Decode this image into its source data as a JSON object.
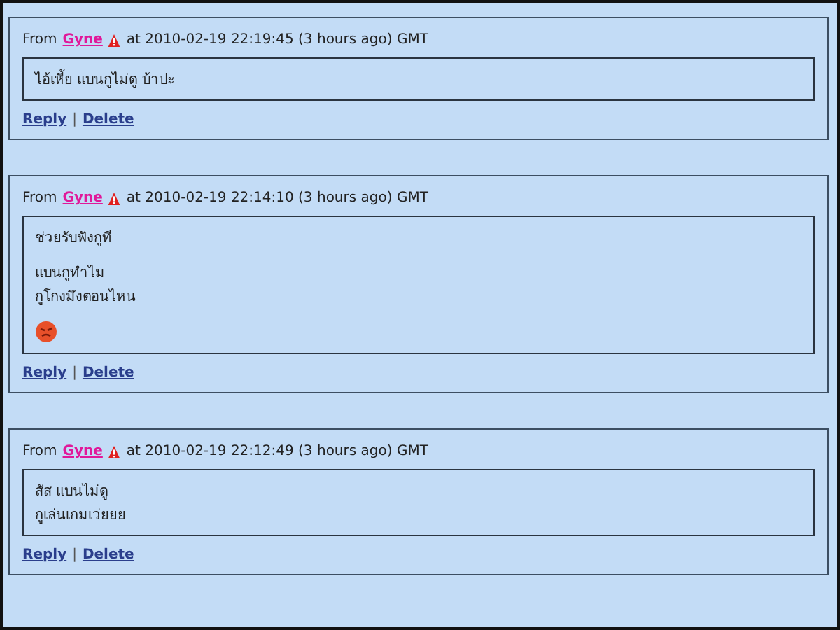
{
  "comments": [
    {
      "from_label": "From",
      "author": "Gyne",
      "timestamp": "at 2010-02-19 22:19:45 (3 hours ago) GMT",
      "paragraphs": [
        [
          "ไอ้เหี้ย แบนกูไม่ดู บ้าปะ"
        ]
      ],
      "emoticon": false,
      "actions": [
        "Reply",
        "Delete"
      ],
      "separator": "|"
    },
    {
      "from_label": "From",
      "author": "Gyne",
      "timestamp": "at 2010-02-19 22:14:10 (3 hours ago) GMT",
      "paragraphs": [
        [
          "ช่วยรับฟังกูที"
        ],
        [
          "แบนกูทำไม",
          "กูโกงมึงตอนไหน"
        ]
      ],
      "emoticon": true,
      "actions": [
        "Reply",
        "Delete"
      ],
      "separator": "|"
    },
    {
      "from_label": "From",
      "author": "Gyne",
      "timestamp": "at 2010-02-19 22:12:49 (3 hours ago) GMT",
      "paragraphs": [
        [
          "สัส แบนไม่ดู",
          "กูเล่นเกมเว่ยยย"
        ]
      ],
      "emoticon": false,
      "actions": [
        "Reply",
        "Delete"
      ],
      "separator": "|"
    }
  ]
}
